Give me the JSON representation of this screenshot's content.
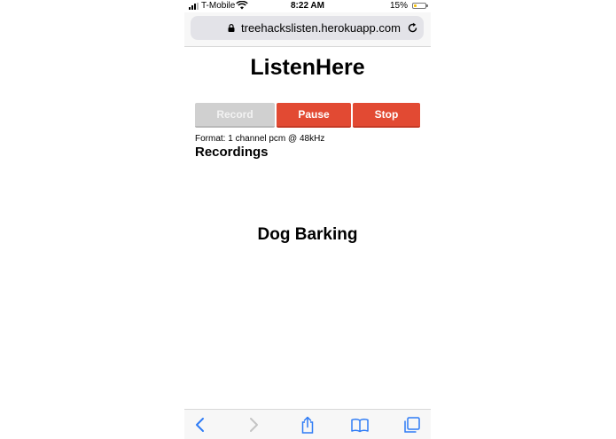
{
  "status_bar": {
    "carrier": "T-Mobile",
    "time": "8:22 AM",
    "battery_percent": "15%",
    "icons": [
      "signal-icon",
      "wifi-icon",
      "battery-icon"
    ]
  },
  "address_bar": {
    "url": "treehackslisten.herokuapp.com",
    "icons": [
      "lock-icon",
      "reload-icon"
    ]
  },
  "page": {
    "title": "ListenHere",
    "buttons": {
      "record": "Record",
      "pause": "Pause",
      "stop": "Stop"
    },
    "format": "Format: 1 channel pcm @ 48kHz",
    "recordings_heading": "Recordings",
    "classification": "Dog Barking"
  },
  "toolbar": {
    "icons": [
      "back-icon",
      "forward-icon",
      "share-icon",
      "bookmarks-icon",
      "tabs-icon"
    ]
  },
  "colors": {
    "accent_red": "#e24a33",
    "disabled_gray": "#d0d0d0",
    "ios_blue": "#2f7cf6"
  }
}
